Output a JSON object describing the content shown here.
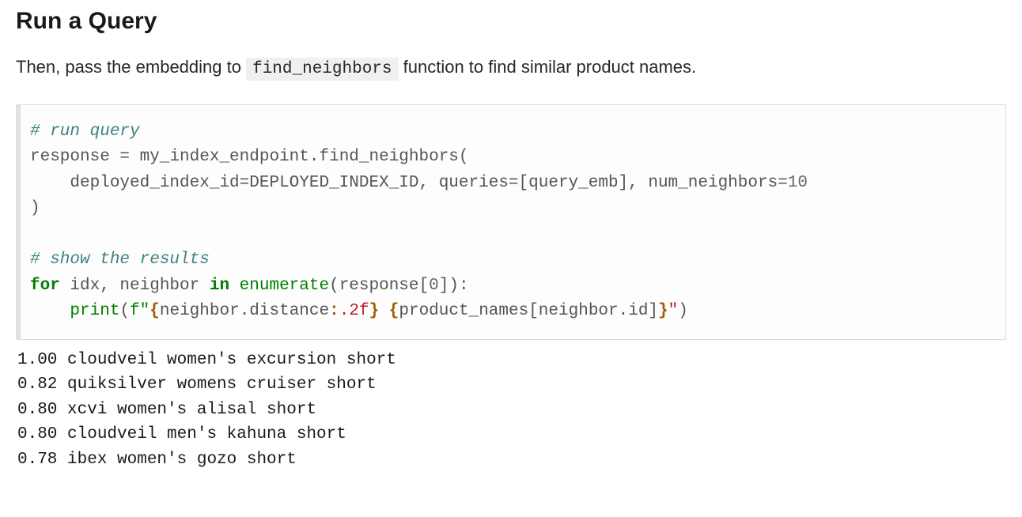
{
  "heading": "Run a Query",
  "description_prefix": "Then, pass the embedding to ",
  "description_code": "find_neighbors",
  "description_suffix": " function to find similar product names.",
  "code": {
    "comment1": "# run query",
    "line2_a": "response ",
    "line2_op": "=",
    "line2_b": " my_index_endpoint",
    "line2_dot": ".",
    "line2_c": "find_neighbors(",
    "line3_a": "    deployed_index_id",
    "line3_op": "=",
    "line3_b": "DEPLOYED_INDEX_ID, queries",
    "line3_op2": "=",
    "line3_c": "[query_emb], num_neighbors",
    "line3_op3": "=",
    "line3_num": "10",
    "line4": ")",
    "comment2": "# show the results",
    "line6_for": "for",
    "line6_a": " idx, neighbor ",
    "line6_in": "in",
    "line6_sp": " ",
    "line6_enum": "enumerate",
    "line6_b": "(response[",
    "line6_zero": "0",
    "line6_c": "]):",
    "line7_indent": "    ",
    "line7_print": "print",
    "line7_a": "(",
    "line7_f": "f\"",
    "line7_b1": "{",
    "line7_s1": "neighbor.distance",
    "line7_fmt": ":",
    "line7_s2": ".2f",
    "line7_b2": "}",
    "line7_sp": " ",
    "line7_b3": "{",
    "line7_s3": "product_names[neighbor.id]",
    "line7_b4": "}",
    "line7_end": "\"",
    "line7_close": ")"
  },
  "output": "1.00 cloudveil women's excursion short\n0.82 quiksilver womens cruiser short\n0.80 xcvi women's alisal short\n0.80 cloudveil men's kahuna short\n0.78 ibex women's gozo short"
}
